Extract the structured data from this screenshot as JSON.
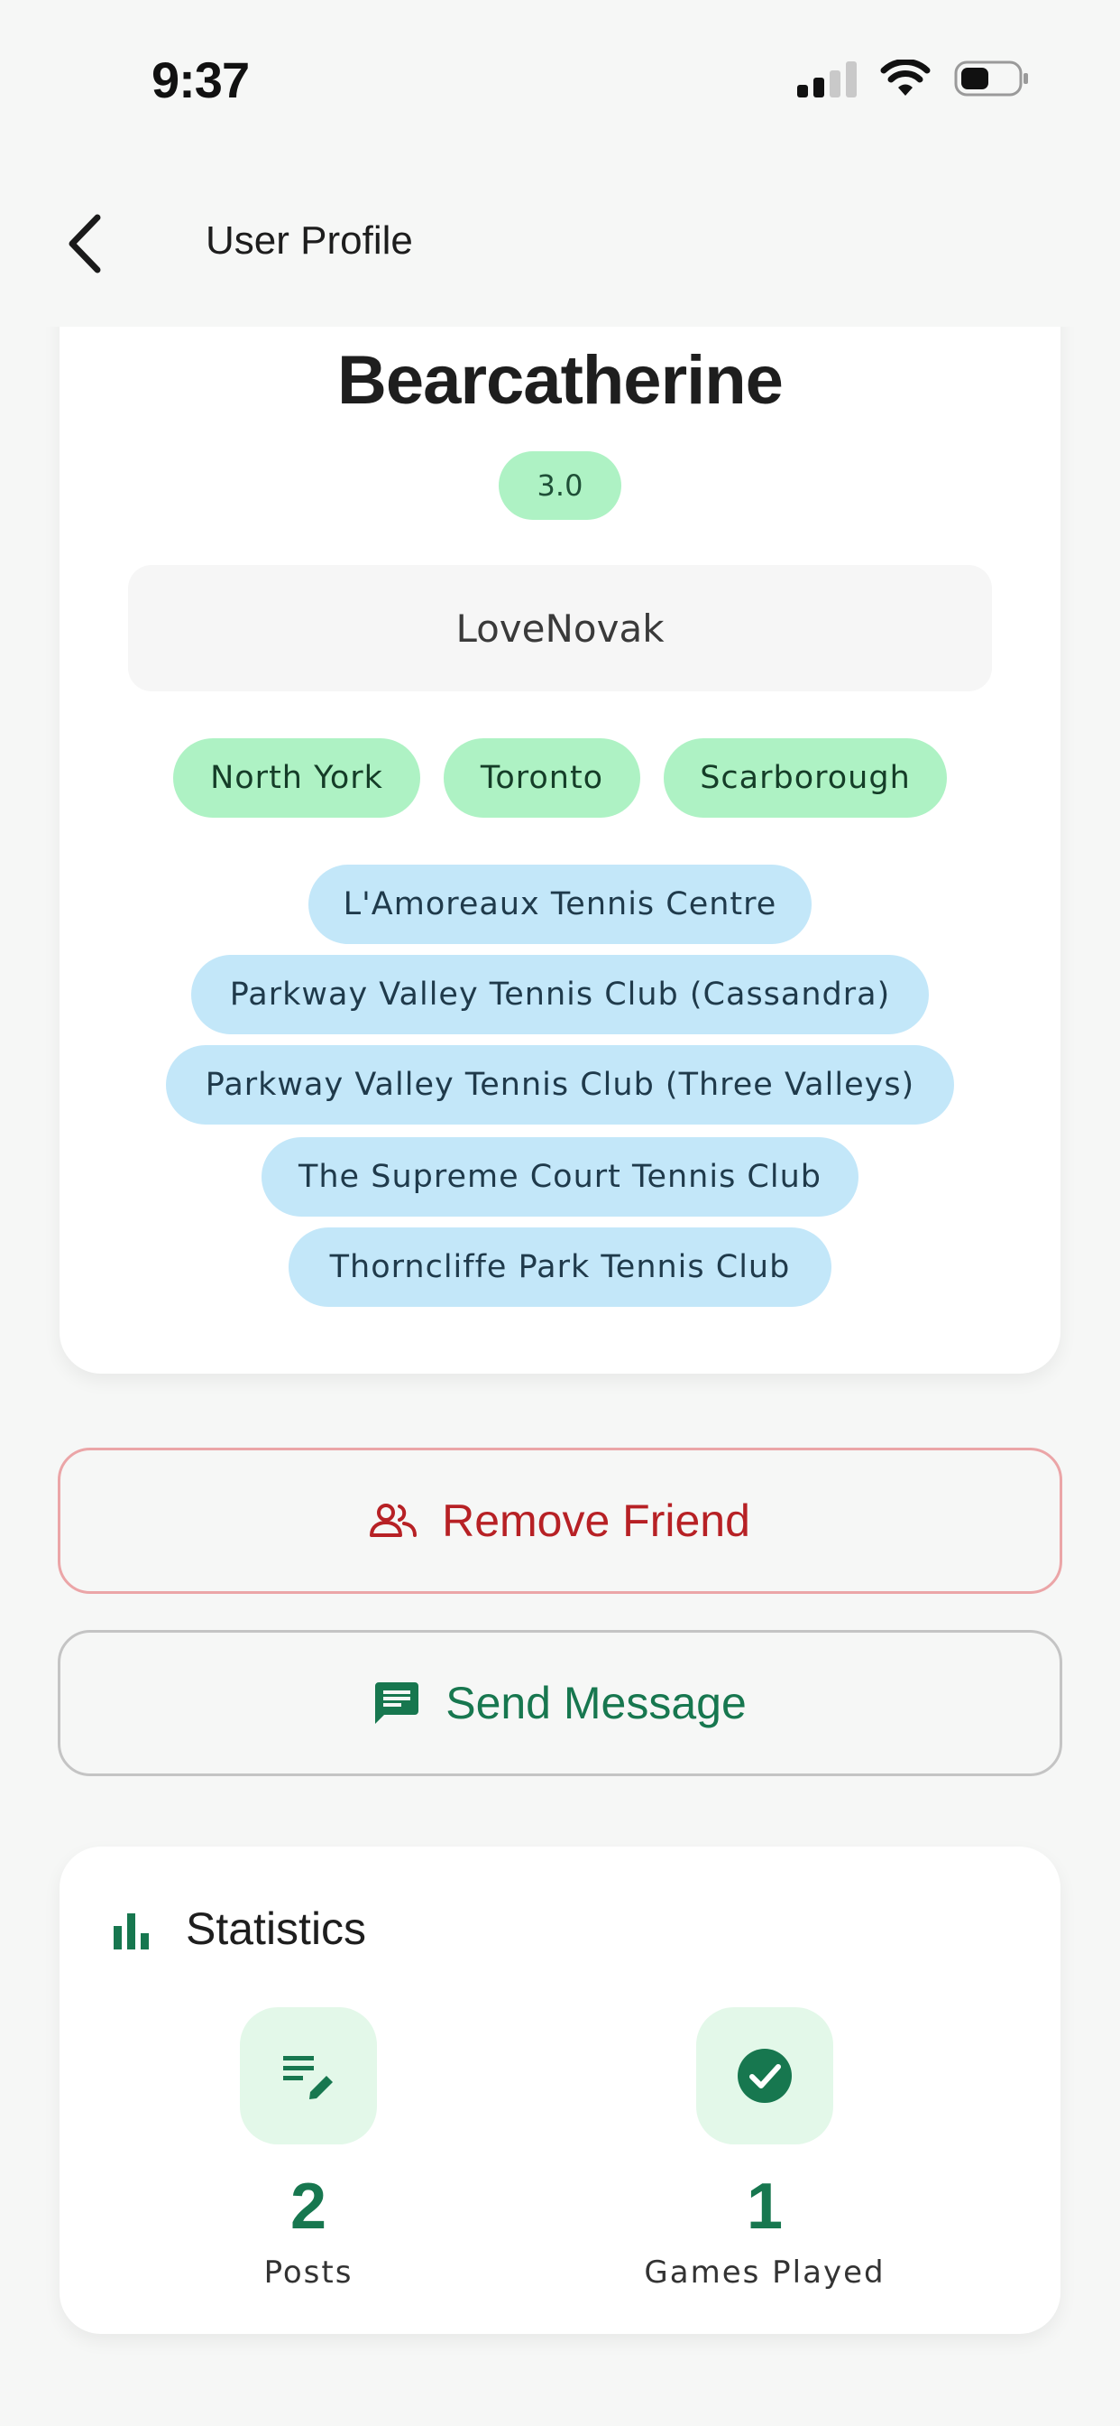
{
  "status_bar": {
    "time": "9:37",
    "icons": [
      "signal-icon",
      "wifi-icon",
      "battery-icon"
    ]
  },
  "header": {
    "title": "User Profile",
    "back_icon": "chevron-left-icon"
  },
  "profile": {
    "name": "Bearcatherine",
    "rating": "3.0",
    "bio": "LoveNovak",
    "areas": [
      "North York",
      "Toronto",
      "Scarborough"
    ],
    "clubs": [
      "L'Amoreaux Tennis Centre",
      "Parkway Valley Tennis Club (Cassandra)",
      "Parkway Valley Tennis Club (Three Valleys)",
      "The Supreme Court Tennis Club",
      "Thorncliffe Park Tennis Club"
    ]
  },
  "actions": {
    "remove_friend": {
      "label": "Remove Friend",
      "icon": "people-icon"
    },
    "send_message": {
      "label": "Send Message",
      "icon": "message-icon"
    }
  },
  "statistics": {
    "title": "Statistics",
    "icon": "bar-chart-icon",
    "items": [
      {
        "value": "2",
        "label": "Posts",
        "icon": "edit-note-icon"
      },
      {
        "value": "1",
        "label": "Games Played",
        "icon": "check-circle-icon"
      }
    ]
  },
  "colors": {
    "accent_green": "#17774f",
    "danger_red": "#b72125",
    "area_chip": "#aef2c4",
    "club_chip": "#c3e7f9",
    "background": "#f6f7f6"
  }
}
